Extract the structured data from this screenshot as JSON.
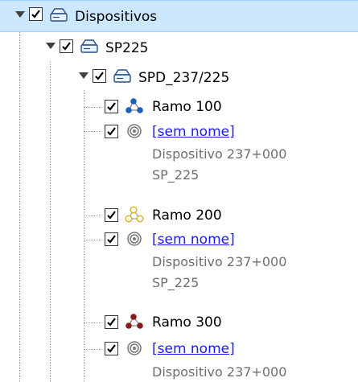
{
  "colors": {
    "selection_bg": "#cce8ff",
    "link": "#1a1aff",
    "secondary_text": "#6e6e6e",
    "ramo_100": "#1e5fbf",
    "ramo_200": "#e0c020",
    "ramo_300": "#8b1a1a"
  },
  "tree": {
    "root": {
      "label": "Dispositivos",
      "checked": true,
      "icon": "drive-icon"
    },
    "sp": {
      "label": "SP225",
      "checked": true,
      "icon": "drive-icon"
    },
    "spd": {
      "label": "SPD_237/225",
      "checked": true,
      "icon": "drive-icon"
    },
    "ramos": [
      {
        "label": "Ramo 100",
        "icon": "network-nodes-icon",
        "device": {
          "label": "[sem nome]",
          "line1": "Dispositivo 237+000",
          "line2": "SP_225",
          "icon": "target-icon"
        }
      },
      {
        "label": "Ramo 200",
        "icon": "network-nodes-icon",
        "device": {
          "label": "[sem nome]",
          "line1": "Dispositivo 237+000",
          "line2": "SP_225",
          "icon": "target-icon"
        }
      },
      {
        "label": "Ramo 300",
        "icon": "network-nodes-icon",
        "device": {
          "label": "[sem nome]",
          "line1": "Dispositivo 237+000",
          "icon": "target-icon"
        }
      }
    ]
  }
}
